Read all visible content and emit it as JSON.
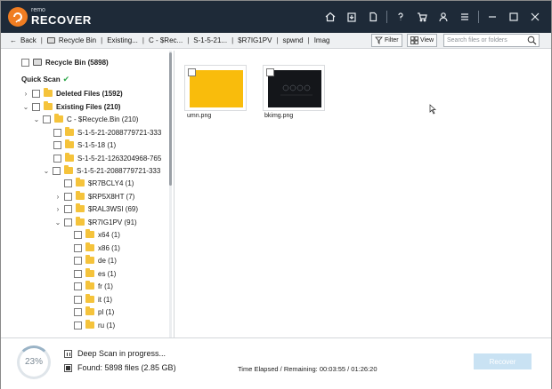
{
  "app": {
    "brand_small": "remo",
    "brand_big": "RECOVER"
  },
  "toolbar_icons": [
    "home-icon",
    "export-icon",
    "document-icon",
    "help-icon",
    "cart-icon",
    "user-icon",
    "menu-icon",
    "minimize-icon",
    "maximize-icon",
    "close-icon"
  ],
  "nav": {
    "back_label": "Back",
    "breadcrumbs": [
      "Recycle Bin",
      "Existing...",
      "C - $Rec...",
      "S-1-5-21...",
      "$R7IG1PV",
      "spwnd",
      "Imag"
    ],
    "filter_label": "Filter",
    "view_label": "View",
    "search_placeholder": "Search files or folders"
  },
  "tree": {
    "root": "Recycle Bin (5898)",
    "quick_scan": "Quick Scan",
    "items": [
      "Deleted Files (1592)",
      "Existing Files (210)",
      "C - $Recycle.Bin (210)",
      "S-1-5-21-2088779721-333",
      "S-1-5-18 (1)",
      "S-1-5-21-1263204968-765",
      "S-1-5-21-2088779721-333",
      "$R7BCLY4 (1)",
      "$RP5X8HT (7)",
      "$RAL3WSI (69)",
      "$R7IG1PV (91)",
      "x64 (1)",
      "x86 (1)",
      "de (1)",
      "es (1)",
      "fr (1)",
      "it (1)",
      "pl (1)",
      "ru (1)"
    ]
  },
  "files": [
    {
      "name": "umn.png"
    },
    {
      "name": "bkimg.png"
    }
  ],
  "status": {
    "progress": "23%",
    "progress_value": 0.23,
    "scan_text": "Deep Scan in progress...",
    "found_text": "Found: 5898 files (2.85 GB)",
    "elapsed": "Time Elapsed / Remaining: 00:03:55 / 01:26:20",
    "recover_label": "Recover"
  },
  "colors": {
    "titlebar": "#1e2a38",
    "accent": "#f07d22",
    "folder": "#f5c33b",
    "recover_disabled": "#c9e2f3",
    "check": "#2ea84a"
  }
}
